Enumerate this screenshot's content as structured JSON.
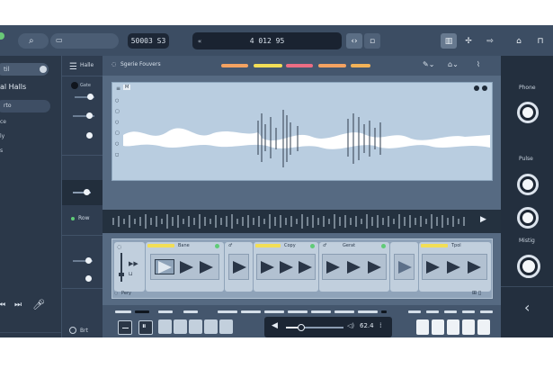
{
  "topbar": {
    "timecode_left": "50003 S3",
    "timecode_center": "4 012 95"
  },
  "sidebar": {
    "search_text": "til",
    "title": "al Halls",
    "selected_item": "rto",
    "items": [
      "ce",
      "ly",
      "s"
    ]
  },
  "column": {
    "header": "Halle",
    "row1_label": "Gate",
    "row2_label": "Row",
    "footer_label": "Brt"
  },
  "main": {
    "header_label": "Sgerie Fouvers",
    "wave_tag": "M",
    "chip_colors": [
      "#f4a261",
      "#f2de56",
      "#ec6d84",
      "#f4a261",
      "#f2b257"
    ]
  },
  "sequencer": {
    "cards": [
      {
        "label": "Bane"
      },
      {
        "label": ""
      },
      {
        "label": "Copy"
      },
      {
        "label": "Gerat"
      },
      {
        "label": ""
      },
      {
        "label": "Tpol"
      }
    ],
    "first_card_label": "Pery"
  },
  "transport": {
    "value": "62.4"
  },
  "rightpanel": {
    "label1": "Phone",
    "label2": "Pulse",
    "label3": "Mistig"
  },
  "colors": {
    "background": "#3a4b60",
    "accent_yellow": "#f2de56",
    "accent_green": "#5fcb77"
  }
}
